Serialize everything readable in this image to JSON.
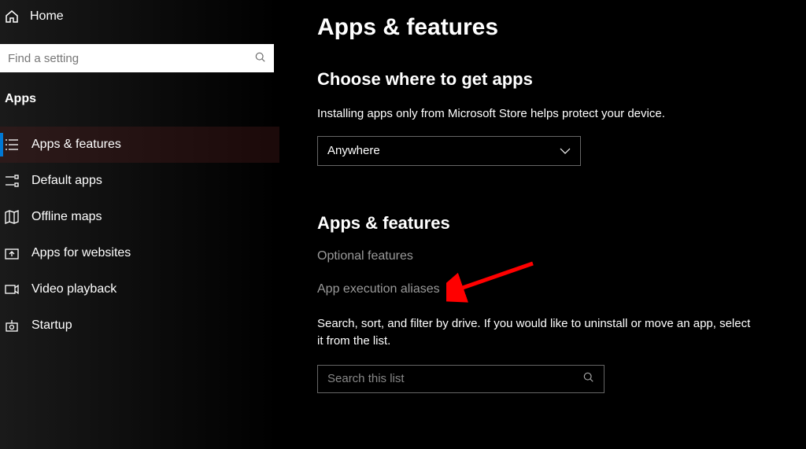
{
  "sidebar": {
    "home_label": "Home",
    "search_placeholder": "Find a setting",
    "category": "Apps",
    "items": [
      {
        "label": "Apps & features"
      },
      {
        "label": "Default apps"
      },
      {
        "label": "Offline maps"
      },
      {
        "label": "Apps for websites"
      },
      {
        "label": "Video playback"
      },
      {
        "label": "Startup"
      }
    ]
  },
  "main": {
    "title": "Apps & features",
    "choose_heading": "Choose where to get apps",
    "choose_description": "Installing apps only from Microsoft Store helps protect your device.",
    "dropdown_value": "Anywhere",
    "apps_heading": "Apps & features",
    "optional_features_link": "Optional features",
    "aliases_link": "App execution aliases",
    "filter_text": "Search, sort, and filter by drive. If you would like to uninstall or move an app, select it from the list.",
    "list_search_placeholder": "Search this list"
  }
}
